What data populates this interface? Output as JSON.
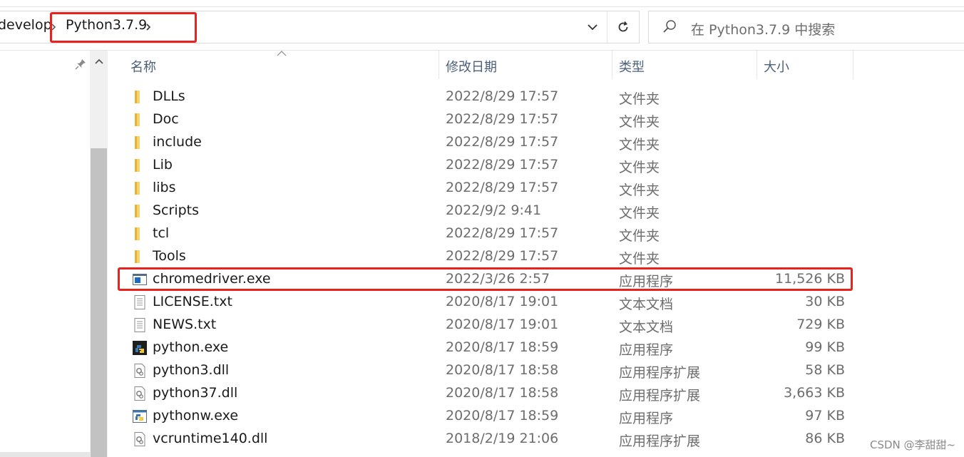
{
  "address_bar": {
    "breadcrumb_prev": "develop",
    "breadcrumb_current": "Python3.7.9"
  },
  "search": {
    "placeholder": "在 Python3.7.9 中搜索"
  },
  "columns": {
    "name": "名称",
    "date": "修改日期",
    "type": "类型",
    "size": "大小"
  },
  "files": [
    {
      "name": "DLLs",
      "date": "2022/8/29 17:57",
      "type": "文件夹",
      "size": "",
      "icon": "folder-icon"
    },
    {
      "name": "Doc",
      "date": "2022/8/29 17:57",
      "type": "文件夹",
      "size": "",
      "icon": "folder-icon"
    },
    {
      "name": "include",
      "date": "2022/8/29 17:57",
      "type": "文件夹",
      "size": "",
      "icon": "folder-icon"
    },
    {
      "name": "Lib",
      "date": "2022/8/29 17:57",
      "type": "文件夹",
      "size": "",
      "icon": "folder-icon"
    },
    {
      "name": "libs",
      "date": "2022/8/29 17:57",
      "type": "文件夹",
      "size": "",
      "icon": "folder-icon"
    },
    {
      "name": "Scripts",
      "date": "2022/9/2 9:41",
      "type": "文件夹",
      "size": "",
      "icon": "folder-icon"
    },
    {
      "name": "tcl",
      "date": "2022/8/29 17:57",
      "type": "文件夹",
      "size": "",
      "icon": "folder-icon"
    },
    {
      "name": "Tools",
      "date": "2022/8/29 17:57",
      "type": "文件夹",
      "size": "",
      "icon": "folder-icon"
    },
    {
      "name": "chromedriver.exe",
      "date": "2022/3/26 2:57",
      "type": "应用程序",
      "size": "11,526 KB",
      "icon": "application-icon"
    },
    {
      "name": "LICENSE.txt",
      "date": "2020/8/17 19:01",
      "type": "文本文档",
      "size": "30 KB",
      "icon": "text-file-icon"
    },
    {
      "name": "NEWS.txt",
      "date": "2020/8/17 19:01",
      "type": "文本文档",
      "size": "729 KB",
      "icon": "text-file-icon"
    },
    {
      "name": "python.exe",
      "date": "2020/8/17 18:59",
      "type": "应用程序",
      "size": "99 KB",
      "icon": "python-console-icon"
    },
    {
      "name": "python3.dll",
      "date": "2020/8/17 18:58",
      "type": "应用程序扩展",
      "size": "58 KB",
      "icon": "dll-file-icon"
    },
    {
      "name": "python37.dll",
      "date": "2020/8/17 18:58",
      "type": "应用程序扩展",
      "size": "3,663 KB",
      "icon": "dll-file-icon"
    },
    {
      "name": "pythonw.exe",
      "date": "2020/8/17 18:59",
      "type": "应用程序",
      "size": "97 KB",
      "icon": "python-window-icon"
    },
    {
      "name": "vcruntime140.dll",
      "date": "2018/2/19 21:06",
      "type": "应用程序扩展",
      "size": "86 KB",
      "icon": "dll-file-icon"
    }
  ],
  "watermark": "CSDN @李甜甜~",
  "colors": {
    "highlight_border": "#e8231f",
    "folder": "#f4c542",
    "header_text": "#4c607a"
  }
}
